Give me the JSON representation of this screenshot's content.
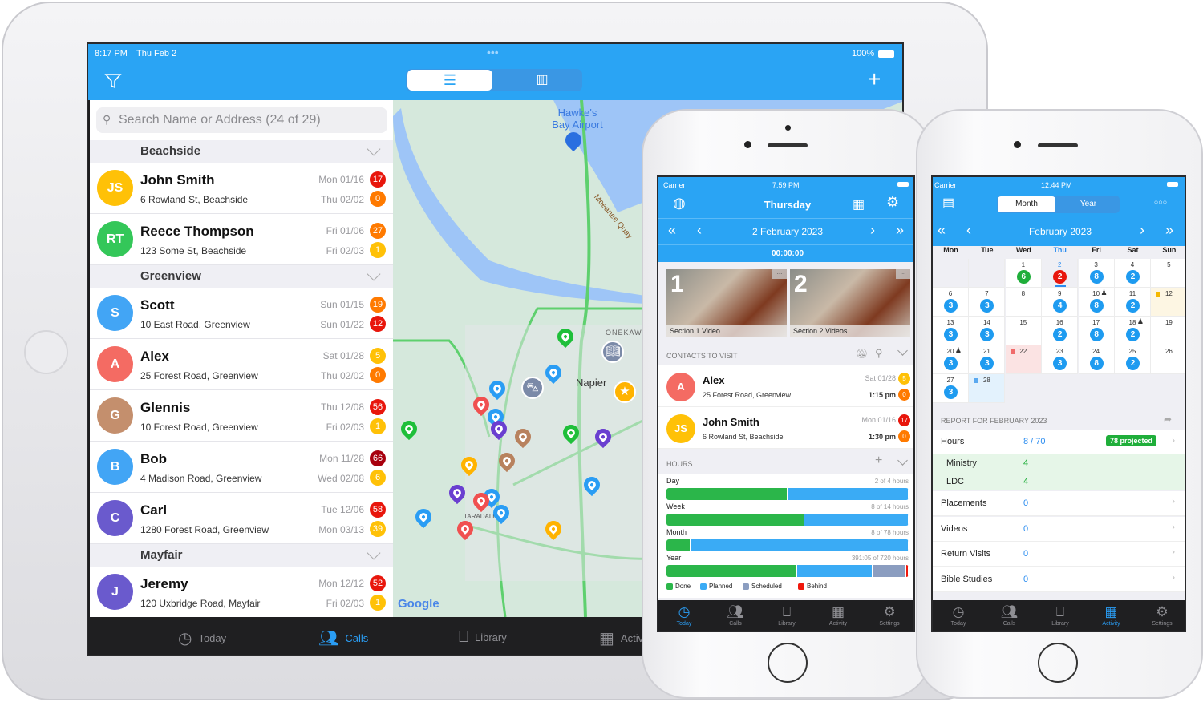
{
  "ipad": {
    "status": {
      "time": "8:17 PM",
      "date": "Thu Feb 2",
      "battery": "100%"
    },
    "nav": {
      "filter_icon": "funnel-icon",
      "list_icon": "list-icon",
      "map_icon": "map-icon",
      "add_icon": "plus-icon"
    },
    "search": {
      "placeholder": "Search Name or Address (24 of 29)"
    },
    "sections": [
      {
        "name": "Beachside",
        "rows": [
          {
            "initials": "JS",
            "name": "John Smith",
            "address": "6 Rowland St, Beachside",
            "date1": "Mon 01/16",
            "badge1": "17",
            "badge1_color": "#e8160c",
            "date2": "Thu 02/02",
            "badge2": "0",
            "badge2_color": "#ff7a00",
            "avatar_color": "#ffc107"
          },
          {
            "initials": "RT",
            "name": "Reece Thompson",
            "address": "123 Some St, Beachside",
            "date1": "Fri 01/06",
            "badge1": "27",
            "badge1_color": "#ff7a00",
            "date2": "Fri 02/03",
            "badge2": "1",
            "badge2_color": "#ffc107",
            "avatar_color": "#34c759"
          }
        ]
      },
      {
        "name": "Greenview",
        "rows": [
          {
            "initials": "S",
            "name": "Scott",
            "address": "10 East Road, Greenview",
            "date1": "Sun 01/15",
            "badge1": "19",
            "badge1_color": "#ff7a00",
            "date2": "Sun 01/22",
            "badge2": "12",
            "badge2_color": "#e8160c",
            "avatar_color": "#42a5f5"
          },
          {
            "initials": "A",
            "name": "Alex",
            "address": "25 Forest Road, Greenview",
            "date1": "Sat 01/28",
            "badge1": "5",
            "badge1_color": "#ffc107",
            "date2": "Thu 02/02",
            "badge2": "0",
            "badge2_color": "#ff7a00",
            "avatar_color": "#f46b63"
          },
          {
            "initials": "G",
            "name": "Glennis",
            "address": "10 Forest Road, Greenview",
            "date1": "Thu 12/08",
            "badge1": "56",
            "badge1_color": "#e8160c",
            "date2": "Fri 02/03",
            "badge2": "1",
            "badge2_color": "#ffc107",
            "avatar_color": "#c48f6d"
          },
          {
            "initials": "B",
            "name": "Bob",
            "address": "4 Madison Road, Greenview",
            "date1": "Mon 11/28",
            "badge1": "66",
            "badge1_color": "#a8000e",
            "date2": "Wed 02/08",
            "badge2": "6",
            "badge2_color": "#ffc107",
            "avatar_color": "#42a5f5"
          },
          {
            "initials": "C",
            "name": "Carl",
            "address": "1280 Forest Road, Greenview",
            "date1": "Tue 12/06",
            "badge1": "58",
            "badge1_color": "#e8160c",
            "date2": "Mon 03/13",
            "badge2": "39",
            "badge2_color": "#ffc107",
            "avatar_color": "#6a5acd"
          }
        ]
      },
      {
        "name": "Mayfair",
        "rows": [
          {
            "initials": "J",
            "name": "Jeremy",
            "address": "120 Uxbridge Road, Mayfair",
            "date1": "Mon 12/12",
            "badge1": "52",
            "badge1_color": "#e8160c",
            "date2": "Fri 02/03",
            "badge2": "1",
            "badge2_color": "#ffc107",
            "avatar_color": "#6a5acd"
          }
        ]
      }
    ],
    "map": {
      "labels": {
        "airport": "Hawke's Bay Airport",
        "quay": "Meeanee Quay",
        "onekawa": "ONEKAWA",
        "napier": "Napier",
        "taradale": "TARADALE",
        "google": "Google"
      }
    },
    "tabs": [
      {
        "label": "Today",
        "icon": "clock-icon"
      },
      {
        "label": "Calls",
        "icon": "people-icon",
        "active": true
      },
      {
        "label": "Library",
        "icon": "tray-icon"
      },
      {
        "label": "Activity",
        "icon": "calendar-icon"
      }
    ]
  },
  "phone_today": {
    "status": {
      "carrier": "Carrier",
      "time": "7:59 PM"
    },
    "title": "Thursday",
    "date": "2 February 2023",
    "timer": "00:00:00",
    "cards": [
      {
        "num": "1",
        "caption": "Section 1 Video"
      },
      {
        "num": "2",
        "caption": "Section 2 Videos"
      }
    ],
    "contacts_header": "CONTACTS TO VISIT",
    "contacts": [
      {
        "initials": "A",
        "name": "Alex",
        "address": "25 Forest Road, Greenview",
        "date": "Sat 01/28",
        "badge1": "5",
        "badge1_color": "#ffc107",
        "time": "1:15 pm",
        "badge2": "0",
        "badge2_color": "#ff7a00",
        "avatar_color": "#f46b63"
      },
      {
        "initials": "JS",
        "name": "John Smith",
        "address": "6 Rowland St, Beachside",
        "date": "Mon 01/16",
        "badge1": "17",
        "badge1_color": "#e8160c",
        "time": "1:30 pm",
        "badge2": "0",
        "badge2_color": "#ff7a00",
        "avatar_color": "#ffc107"
      }
    ],
    "hours_header": "HOURS",
    "hours": [
      {
        "label": "Day",
        "summary": "2 of 4 hours",
        "done": 50,
        "planned": 50,
        "scheduled": 0,
        "behind": 0
      },
      {
        "label": "Week",
        "summary": "8 of 14 hours",
        "done": 57,
        "planned": 43,
        "scheduled": 0,
        "behind": 0
      },
      {
        "label": "Month",
        "summary": "8 of 78 hours",
        "done": 10,
        "planned": 90,
        "scheduled": 0,
        "behind": 0
      },
      {
        "label": "Year",
        "summary": "391:05 of 720 hours",
        "done": 54,
        "planned": 31,
        "scheduled": 14,
        "behind": 1
      }
    ],
    "legend": [
      {
        "label": "Done",
        "color": "#2bb64a"
      },
      {
        "label": "Planned",
        "color": "#3aabf5"
      },
      {
        "label": "Scheduled",
        "color": "#8b9dc0"
      },
      {
        "label": "Behind",
        "color": "#f0180c"
      }
    ],
    "tabs": [
      {
        "label": "Today",
        "active": true
      },
      {
        "label": "Calls"
      },
      {
        "label": "Library"
      },
      {
        "label": "Activity"
      },
      {
        "label": "Settings"
      }
    ]
  },
  "phone_activity": {
    "status": {
      "carrier": "Carrier",
      "time": "12:44 PM"
    },
    "segments": [
      "Month",
      "Year"
    ],
    "month": "February 2023",
    "weekdays": [
      "Mon",
      "Tue",
      "Wed",
      "Thu",
      "Fri",
      "Sat",
      "Sun"
    ],
    "weeks": [
      [
        null,
        null,
        {
          "d": "1",
          "c": "6",
          "col": "#1fae3a"
        },
        {
          "d": "2",
          "c": "2",
          "col": "#e8160c",
          "today": true
        },
        {
          "d": "3",
          "c": "8"
        },
        {
          "d": "4",
          "c": "2"
        },
        {
          "d": "5"
        }
      ],
      [
        {
          "d": "6",
          "c": "3"
        },
        {
          "d": "7",
          "c": "3"
        },
        {
          "d": "8"
        },
        {
          "d": "9",
          "c": "4"
        },
        {
          "d": "10",
          "c": "8",
          "person": true
        },
        {
          "d": "11",
          "c": "2"
        },
        {
          "d": "12",
          "bg": "#fdf6e3",
          "note": "#f5b800"
        }
      ],
      [
        {
          "d": "13",
          "c": "3"
        },
        {
          "d": "14",
          "c": "3"
        },
        {
          "d": "15"
        },
        {
          "d": "16",
          "c": "2"
        },
        {
          "d": "17",
          "c": "8"
        },
        {
          "d": "18",
          "c": "2",
          "person": true
        },
        {
          "d": "19"
        }
      ],
      [
        {
          "d": "20",
          "c": "3",
          "person": true
        },
        {
          "d": "21",
          "c": "3"
        },
        {
          "d": "22",
          "bg": "#fbe3e3",
          "note": "#f06b6b"
        },
        {
          "d": "23",
          "c": "3"
        },
        {
          "d": "24",
          "c": "8"
        },
        {
          "d": "25",
          "c": "2"
        },
        {
          "d": "26"
        }
      ],
      [
        {
          "d": "27",
          "c": "3"
        },
        {
          "d": "28",
          "bg": "#e3f2fd",
          "note": "#5aa9f0"
        }
      ]
    ],
    "report_header": "REPORT FOR FEBRUARY 2023",
    "hours": {
      "label": "Hours",
      "value": "8 / 70",
      "projected": "78 projected"
    },
    "sub": [
      {
        "label": "Ministry",
        "value": "4"
      },
      {
        "label": "LDC",
        "value": "4"
      }
    ],
    "rows": [
      {
        "label": "Placements",
        "value": "0"
      },
      {
        "label": "Videos",
        "value": "0"
      },
      {
        "label": "Return Visits",
        "value": "0"
      },
      {
        "label": "Bible Studies",
        "value": "0"
      }
    ],
    "tabs": [
      {
        "label": "Today"
      },
      {
        "label": "Calls"
      },
      {
        "label": "Library"
      },
      {
        "label": "Activity",
        "active": true
      },
      {
        "label": "Settings"
      }
    ]
  },
  "colors": {
    "accent": "#2aa4f4",
    "tabbar": "#1f1f21"
  }
}
